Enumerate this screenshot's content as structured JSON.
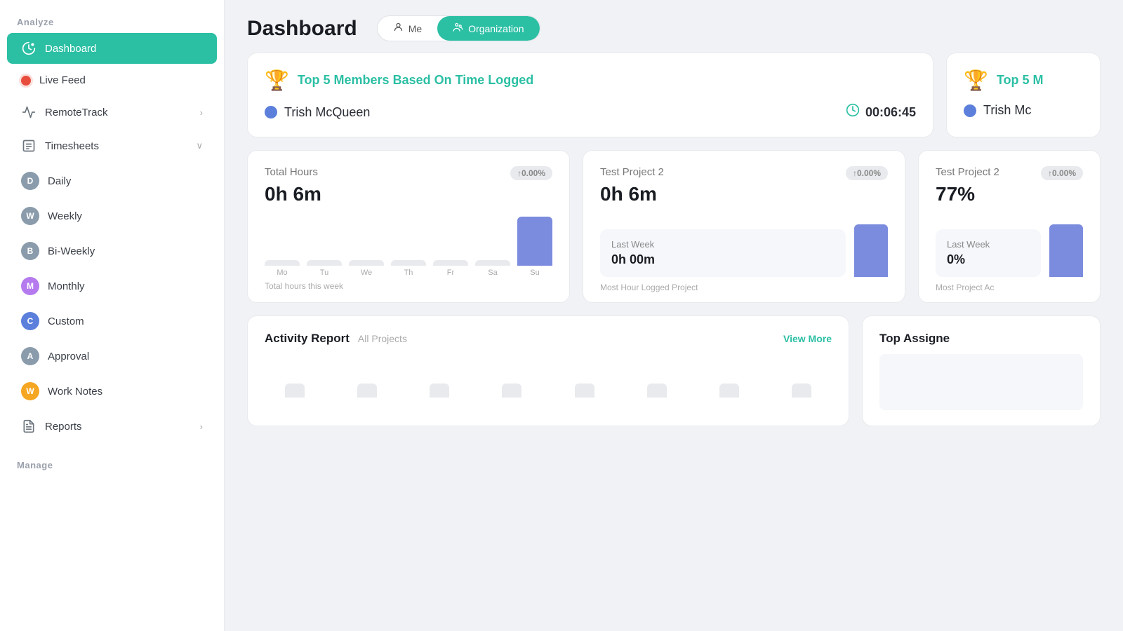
{
  "sidebar": {
    "section_analyze": "Analyze",
    "section_manage": "Manage",
    "items": [
      {
        "id": "dashboard",
        "label": "Dashboard",
        "icon": "gauge",
        "active": true,
        "avatar": null,
        "hasChevron": false
      },
      {
        "id": "live-feed",
        "label": "Live Feed",
        "icon": "live-dot",
        "active": false,
        "avatar": null,
        "hasChevron": false
      },
      {
        "id": "remotetrack",
        "label": "RemoteTrack",
        "icon": "activity",
        "active": false,
        "avatar": null,
        "hasChevron": true
      },
      {
        "id": "timesheets",
        "label": "Timesheets",
        "icon": "file-text",
        "active": false,
        "avatar": null,
        "hasChevron": true,
        "expanded": true
      },
      {
        "id": "daily",
        "label": "Daily",
        "icon": null,
        "avatar": "D",
        "avatarColor": "#6c757d",
        "active": false,
        "hasChevron": false,
        "sub": true
      },
      {
        "id": "weekly",
        "label": "Weekly",
        "icon": null,
        "avatar": "W",
        "avatarColor": "#6c757d",
        "active": false,
        "hasChevron": false,
        "sub": true
      },
      {
        "id": "biweekly",
        "label": "Bi-Weekly",
        "icon": null,
        "avatar": "B",
        "avatarColor": "#6c757d",
        "active": false,
        "hasChevron": false,
        "sub": true
      },
      {
        "id": "monthly",
        "label": "Monthly",
        "icon": null,
        "avatar": "M",
        "avatarColor": "#b57bee",
        "active": false,
        "hasChevron": false,
        "sub": true
      },
      {
        "id": "custom",
        "label": "Custom",
        "icon": null,
        "avatar": "C",
        "avatarColor": "#5b7fdb",
        "active": false,
        "hasChevron": false,
        "sub": true
      },
      {
        "id": "approval",
        "label": "Approval",
        "icon": null,
        "avatar": "A",
        "avatarColor": "#6c757d",
        "active": false,
        "hasChevron": false,
        "sub": true
      },
      {
        "id": "worknotes",
        "label": "Work Notes",
        "icon": null,
        "avatar": "W",
        "avatarColor": "#f5a623",
        "active": false,
        "hasChevron": false,
        "sub": true
      },
      {
        "id": "reports",
        "label": "Reports",
        "icon": "file-report",
        "active": false,
        "avatar": null,
        "hasChevron": true
      }
    ]
  },
  "header": {
    "title": "Dashboard",
    "tab_me": "Me",
    "tab_organization": "Organization",
    "active_tab": "organization"
  },
  "top_card": {
    "title": "Top 5 Members Based On Time Logged",
    "member_name": "Trish McQueen",
    "time": "00:06:45"
  },
  "top_card_right": {
    "title": "Top 5 M",
    "member_name": "Trish Mc"
  },
  "total_hours_card": {
    "label": "Total Hours",
    "badge": "↑0.00%",
    "value": "0h 6m",
    "footer": "Total hours this week",
    "bars": [
      {
        "day": "Mo",
        "height": 8,
        "active": false
      },
      {
        "day": "Tu",
        "height": 8,
        "active": false
      },
      {
        "day": "We",
        "height": 8,
        "active": false
      },
      {
        "day": "Th",
        "height": 8,
        "active": false
      },
      {
        "day": "Fr",
        "height": 8,
        "active": false
      },
      {
        "day": "Sa",
        "height": 8,
        "active": false
      },
      {
        "day": "Su",
        "height": 70,
        "active": true
      }
    ]
  },
  "test_project_card": {
    "label": "Test Project 2",
    "badge": "↑0.00%",
    "value": "0h 6m",
    "footer": "Most Hour Logged Project",
    "last_week_label": "Last Week",
    "last_week_value": "0h 00m"
  },
  "test_project_card2": {
    "label": "Test Project 2",
    "badge": "↑0.00%",
    "value": "77%",
    "footer": "Most Project Ac",
    "last_week_label": "Last Week",
    "last_week_value": "0%"
  },
  "activity_card": {
    "title": "Activity Report",
    "subtitle": "All Projects",
    "view_more": "View More"
  },
  "top_assignee_card": {
    "title": "Top Assigne"
  }
}
